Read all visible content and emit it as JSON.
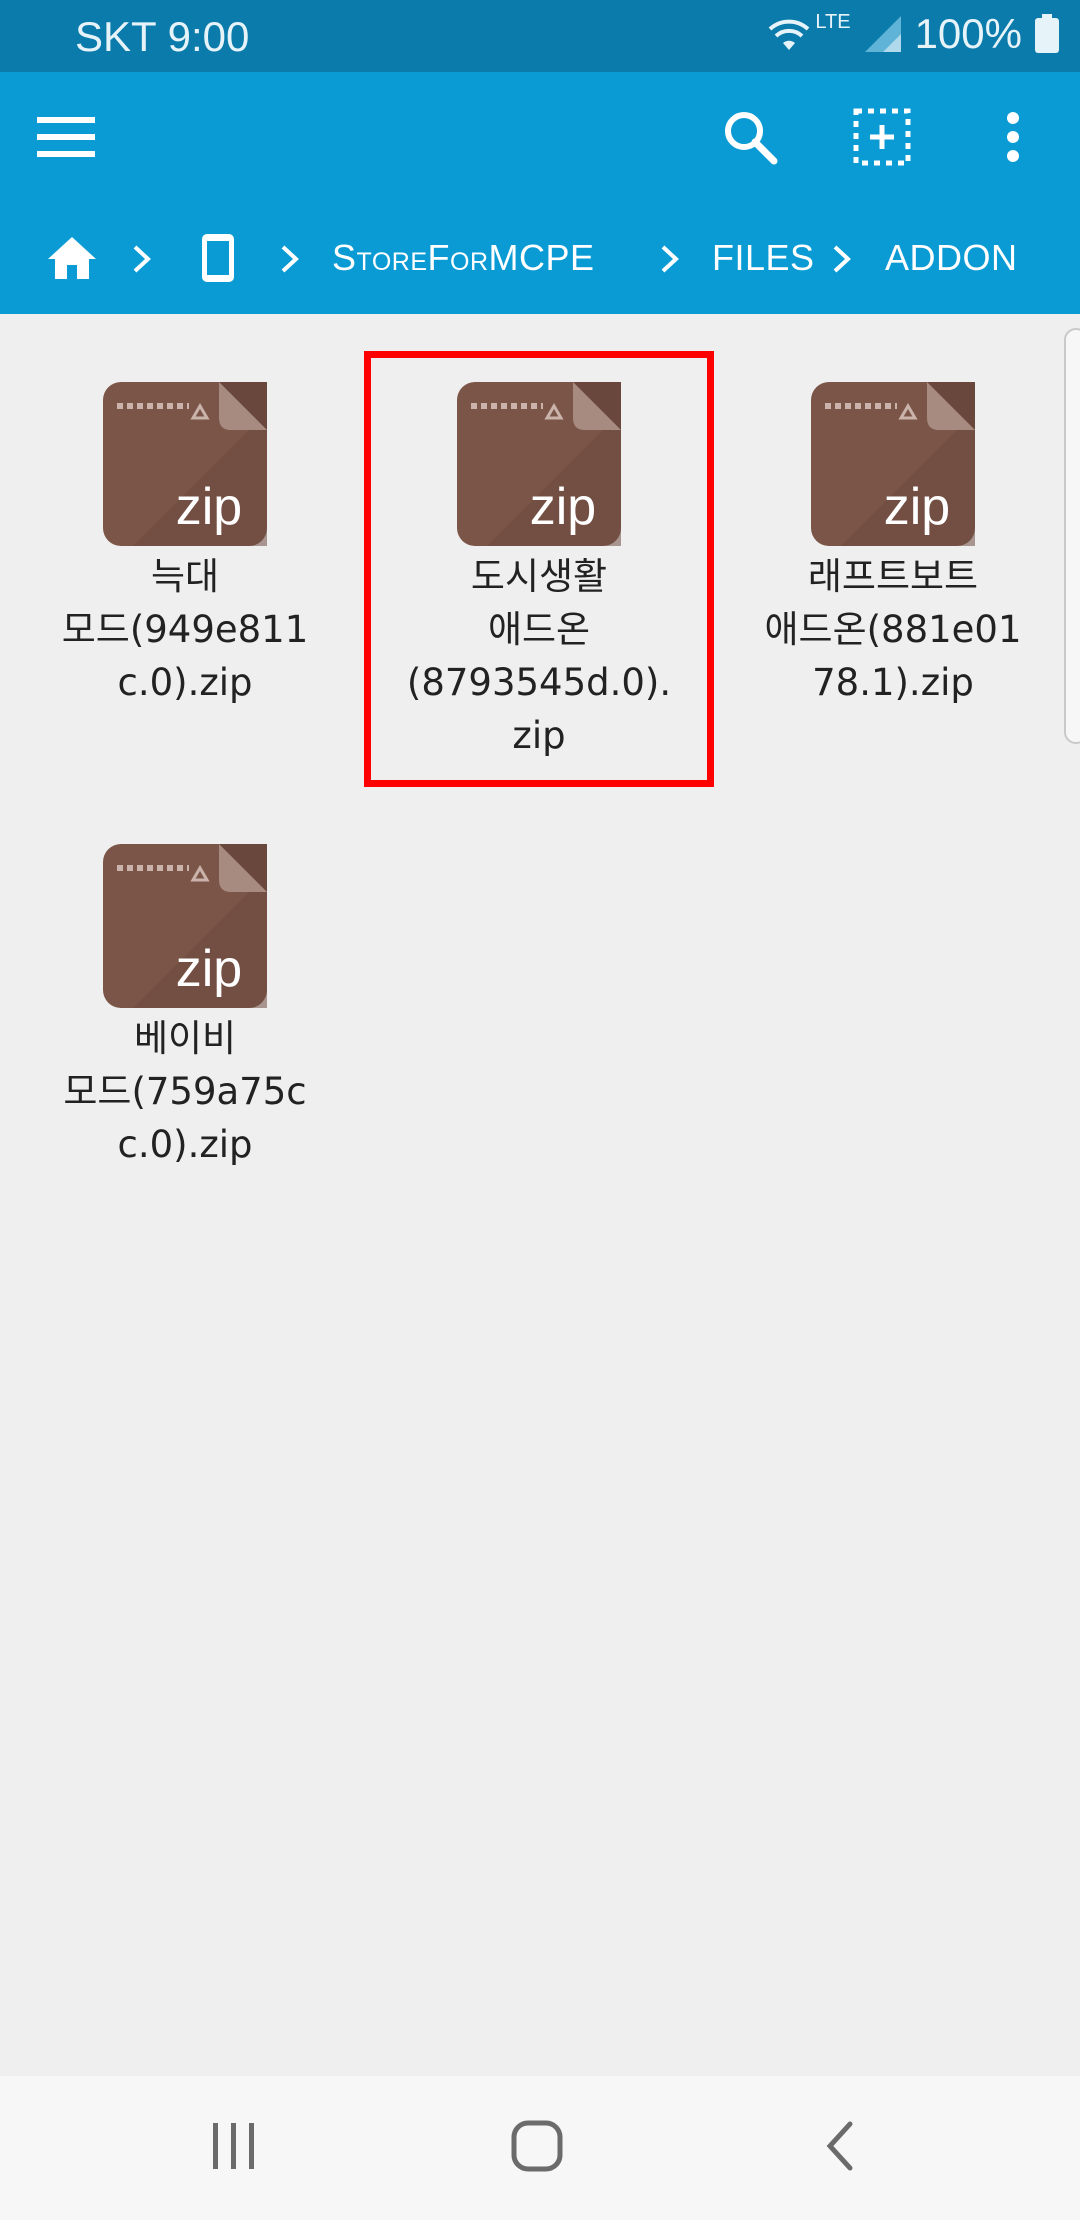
{
  "status_bar": {
    "carrier_time": "SKT 9:00",
    "network": "LTE",
    "battery": "100%"
  },
  "toolbar": {
    "icons": [
      "menu-icon",
      "search-icon",
      "select-add-icon",
      "more-vert-icon"
    ]
  },
  "breadcrumb": {
    "items": [
      "home-icon",
      "phone-icon",
      "StoreForMCPE",
      "FILES",
      "ADDON"
    ],
    "store_label": "StoreForMCPE",
    "files_label": "FILES",
    "addon_label": "ADDON"
  },
  "files": [
    {
      "name": "늑대\n모드(949e811\nc.0).zip",
      "icon_label": "zip"
    },
    {
      "name": "도시생활\n애드온\n(8793545d.0).\nzip",
      "icon_label": "zip",
      "highlighted": true
    },
    {
      "name": "래프트보트\n애드온(881e01\n78.1).zip",
      "icon_label": "zip"
    },
    {
      "name": "베이비\n모드(759a75c\nc.0).zip",
      "icon_label": "zip"
    }
  ],
  "colors": {
    "status_bar": "#0a7bab",
    "app_bar": "#0a9bd5",
    "zip_icon": "#7a5548",
    "highlight": "#ff0000",
    "background": "#efefef"
  }
}
